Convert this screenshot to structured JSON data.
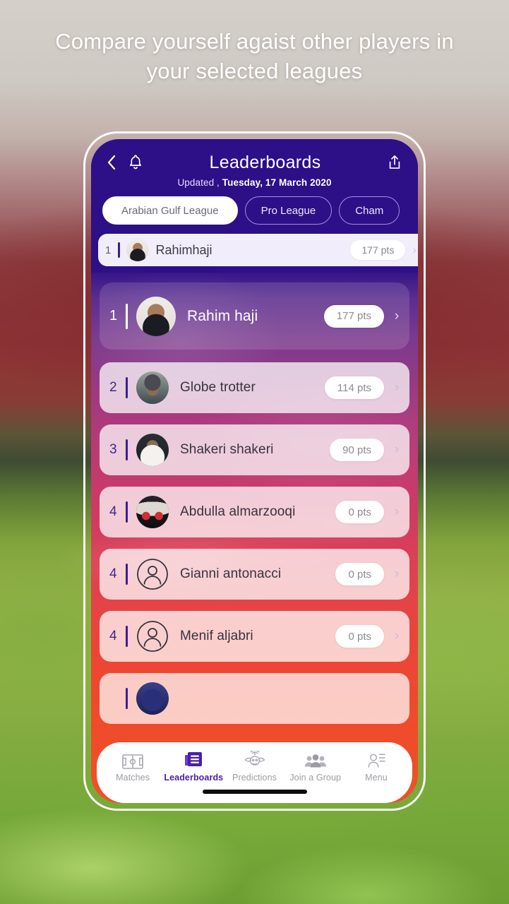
{
  "headline": "Compare yourself agaist other players in your selected leagues",
  "app": {
    "header": {
      "title": "Leaderboards",
      "updated_prefix": "Updated ,",
      "updated_date": "Tuesday, 17 March 2020",
      "back_icon": "chevron-left-icon",
      "bell_icon": "bell-icon",
      "share_icon": "share-icon"
    },
    "league_chips": [
      {
        "label": "Arabian Gulf League",
        "selected": true
      },
      {
        "label": "Pro League",
        "selected": false
      },
      {
        "label": "Cham",
        "selected": false
      }
    ],
    "my_row": {
      "rank": "1",
      "name": "Rahimhaji",
      "points": "177 pts",
      "chevron": "›"
    },
    "leaderboard": [
      {
        "rank": "1",
        "name": "Rahim haji",
        "points": "177 pts",
        "avatar": "photo-suit",
        "highlight": true
      },
      {
        "rank": "2",
        "name": "Globe trotter",
        "points": "114 pts",
        "avatar": "photo-cap",
        "highlight": false
      },
      {
        "rank": "3",
        "name": "Shakeri shakeri",
        "points": "90 pts",
        "avatar": "photo-thobe",
        "highlight": false
      },
      {
        "rank": "4",
        "name": "Abdulla almarzooqi",
        "points": "0 pts",
        "avatar": "photo-car",
        "highlight": false
      },
      {
        "rank": "4",
        "name": "Gianni antonacci",
        "points": "0 pts",
        "avatar": "default-person-icon",
        "highlight": false
      },
      {
        "rank": "4",
        "name": "Menif aljabri",
        "points": "0 pts",
        "avatar": "default-person-icon",
        "highlight": false
      }
    ],
    "bottom_nav": [
      {
        "label": "Matches",
        "icon": "pitch-icon",
        "active": false
      },
      {
        "label": "Leaderboards",
        "icon": "list-document-icon",
        "active": true
      },
      {
        "label": "Predictions",
        "icon": "oracle-icon",
        "active": false
      },
      {
        "label": "Join a Group",
        "icon": "people-group-icon",
        "active": false
      },
      {
        "label": "Menu",
        "icon": "person-lines-icon",
        "active": false
      }
    ]
  },
  "colors": {
    "header_purple": "#2d0f87",
    "accent_purple": "#4b1fa8",
    "body_gradient_top": "#2c0f86",
    "body_gradient_bottom": "#ef5128"
  }
}
